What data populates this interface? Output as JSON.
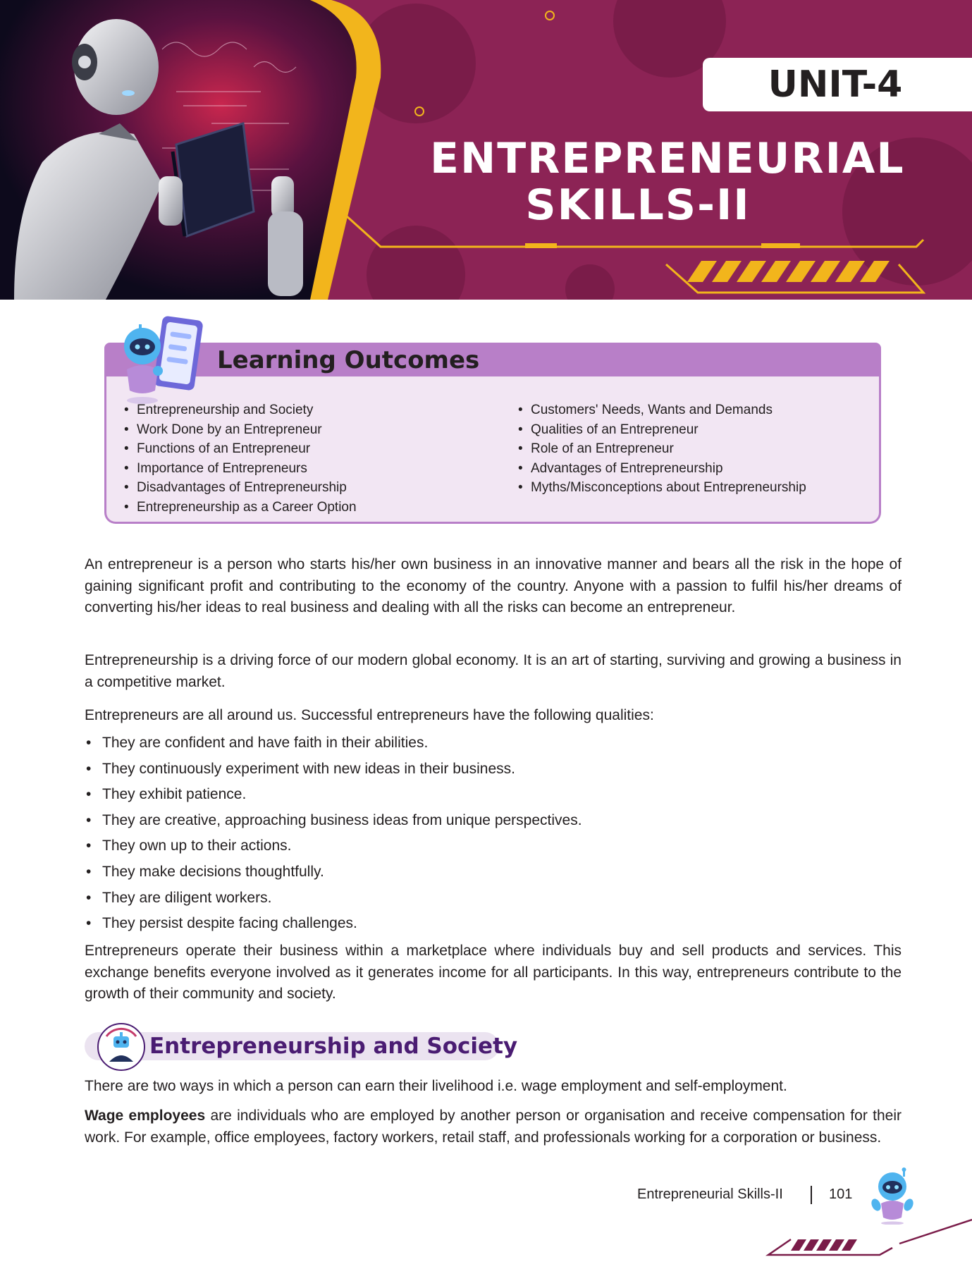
{
  "banner": {
    "unit": "UNIT-4",
    "title_line1": "ENTREPRENEURIAL",
    "title_line2": "SKILLS-II"
  },
  "learning_outcomes": {
    "title": "Learning Outcomes",
    "left": [
      "Entrepreneurship and Society",
      "Work Done by an Entrepreneur",
      "Functions of an Entrepreneur",
      "Importance of Entrepreneurs",
      "Disadvantages of Entrepreneurship",
      "Entrepreneurship as a Career Option"
    ],
    "right": [
      "Customers' Needs, Wants and Demands",
      "Qualities of an Entrepreneur",
      "Role of an Entrepreneur",
      "Advantages of Entrepreneurship",
      "Myths/Misconceptions about Entrepreneurship"
    ]
  },
  "body": {
    "p1": "An entrepreneur is a person who starts his/her own business in an innovative manner and bears all the risk in the hope of gaining significant profit and contributing to the economy of the country. Anyone with a passion to fulfil his/her dreams of converting  his/her ideas to real business and dealing with all the risks can become an entrepreneur.",
    "p2": "Entrepreneurship is a driving force of our modern global economy. It is an art of starting, surviving and growing a business in a competitive market.",
    "p3": "Entrepreneurs are all around us. Successful entrepreneurs have the following qualities:",
    "qualities": [
      "They are confident and have faith in their abilities.",
      "They continuously experiment with new ideas in their business.",
      "They exhibit patience.",
      "They are creative, approaching business ideas from unique perspectives.",
      "They own up to their actions.",
      "They make decisions thoughtfully.",
      "They are diligent workers.",
      "They persist despite facing challenges."
    ],
    "p4": "Entrepreneurs operate their business within a marketplace where individuals buy and sell products and services. This exchange benefits everyone involved as it generates income for all participants. In this way, entrepreneurs contribute to the growth of their community and society."
  },
  "section": {
    "title": "Entrepreneurship and Society",
    "p1": "There are two ways in which a person can earn their livelihood i.e. wage employment and self-employment.",
    "p2_bold": "Wage employees",
    "p2_rest": " are individuals who are employed by another person or organisation and receive compensation for their work. For example, office employees, factory workers, retail staff, and professionals working for a corporation or business."
  },
  "footer": {
    "label": "Entrepreneurial Skills-II",
    "page": "101"
  },
  "colors": {
    "banner": "#8c2355",
    "accent_yellow": "#f2b51c",
    "outcomes_header": "#b87fc8",
    "outcomes_body": "#f2e6f3",
    "section_title": "#4a1c72"
  },
  "icons": {
    "banner_art": "robot-reading-book-illustration",
    "outcomes": "robot-with-tablet-icon",
    "section": "robot-avatar-icon",
    "footer": "robot-mascot-icon"
  }
}
